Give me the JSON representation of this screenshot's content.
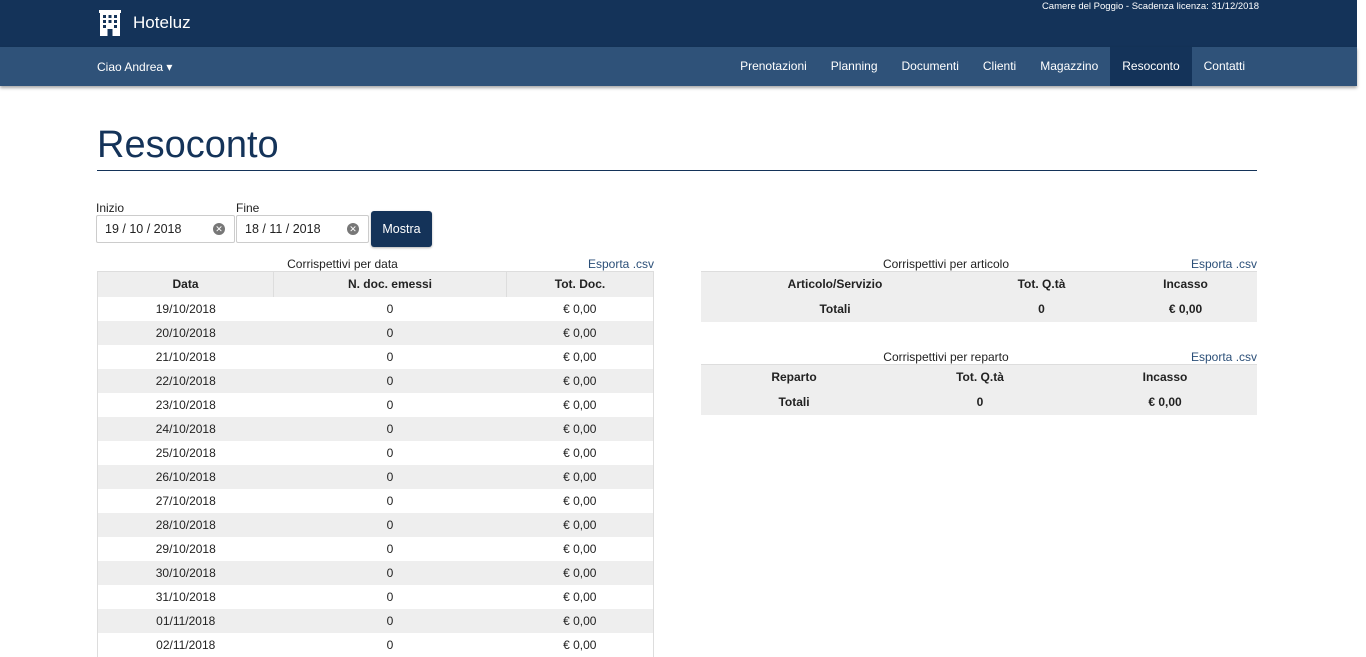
{
  "app": {
    "name": "Hoteluz",
    "license": "Camere del Poggio - Scadenza licenza: 31/12/2018"
  },
  "navbar": {
    "greeting": "Ciao Andrea ▾",
    "items": [
      "Prenotazioni",
      "Planning",
      "Documenti",
      "Clienti",
      "Magazzino",
      "Resoconto",
      "Contatti"
    ],
    "active": "Resoconto"
  },
  "page": {
    "title": "Resoconto"
  },
  "filters": {
    "start_label": "Inizio",
    "start_value": "19 / 10 / 2018",
    "end_label": "Fine",
    "end_value": "18 / 11 / 2018",
    "button": "Mostra"
  },
  "by_date": {
    "caption": "Corrispettivi per data",
    "export": "Esporta .csv",
    "headers": [
      "Data",
      "N. doc. emessi",
      "Tot. Doc."
    ],
    "rows": [
      [
        "19/10/2018",
        "0",
        "€ 0,00"
      ],
      [
        "20/10/2018",
        "0",
        "€ 0,00"
      ],
      [
        "21/10/2018",
        "0",
        "€ 0,00"
      ],
      [
        "22/10/2018",
        "0",
        "€ 0,00"
      ],
      [
        "23/10/2018",
        "0",
        "€ 0,00"
      ],
      [
        "24/10/2018",
        "0",
        "€ 0,00"
      ],
      [
        "25/10/2018",
        "0",
        "€ 0,00"
      ],
      [
        "26/10/2018",
        "0",
        "€ 0,00"
      ],
      [
        "27/10/2018",
        "0",
        "€ 0,00"
      ],
      [
        "28/10/2018",
        "0",
        "€ 0,00"
      ],
      [
        "29/10/2018",
        "0",
        "€ 0,00"
      ],
      [
        "30/10/2018",
        "0",
        "€ 0,00"
      ],
      [
        "31/10/2018",
        "0",
        "€ 0,00"
      ],
      [
        "01/11/2018",
        "0",
        "€ 0,00"
      ],
      [
        "02/11/2018",
        "0",
        "€ 0,00"
      ]
    ]
  },
  "by_article": {
    "caption": "Corrispettivi per articolo",
    "export": "Esporta .csv",
    "headers": [
      "Articolo/Servizio",
      "Tot. Q.tà",
      "Incasso"
    ],
    "totals": [
      "Totali",
      "0",
      "€ 0,00"
    ]
  },
  "by_department": {
    "caption": "Corrispettivi per reparto",
    "export": "Esporta .csv",
    "headers": [
      "Reparto",
      "Tot. Q.tà",
      "Incasso"
    ],
    "totals": [
      "Totali",
      "0",
      "€ 0,00"
    ]
  },
  "colors": {
    "topbar": "#143359",
    "navbar": "#2f5279",
    "accent": "#143359",
    "stripe": "#eeeeee"
  },
  "icons": {
    "brand": "hotel-building-icon",
    "clear": "clear-circle-icon"
  }
}
